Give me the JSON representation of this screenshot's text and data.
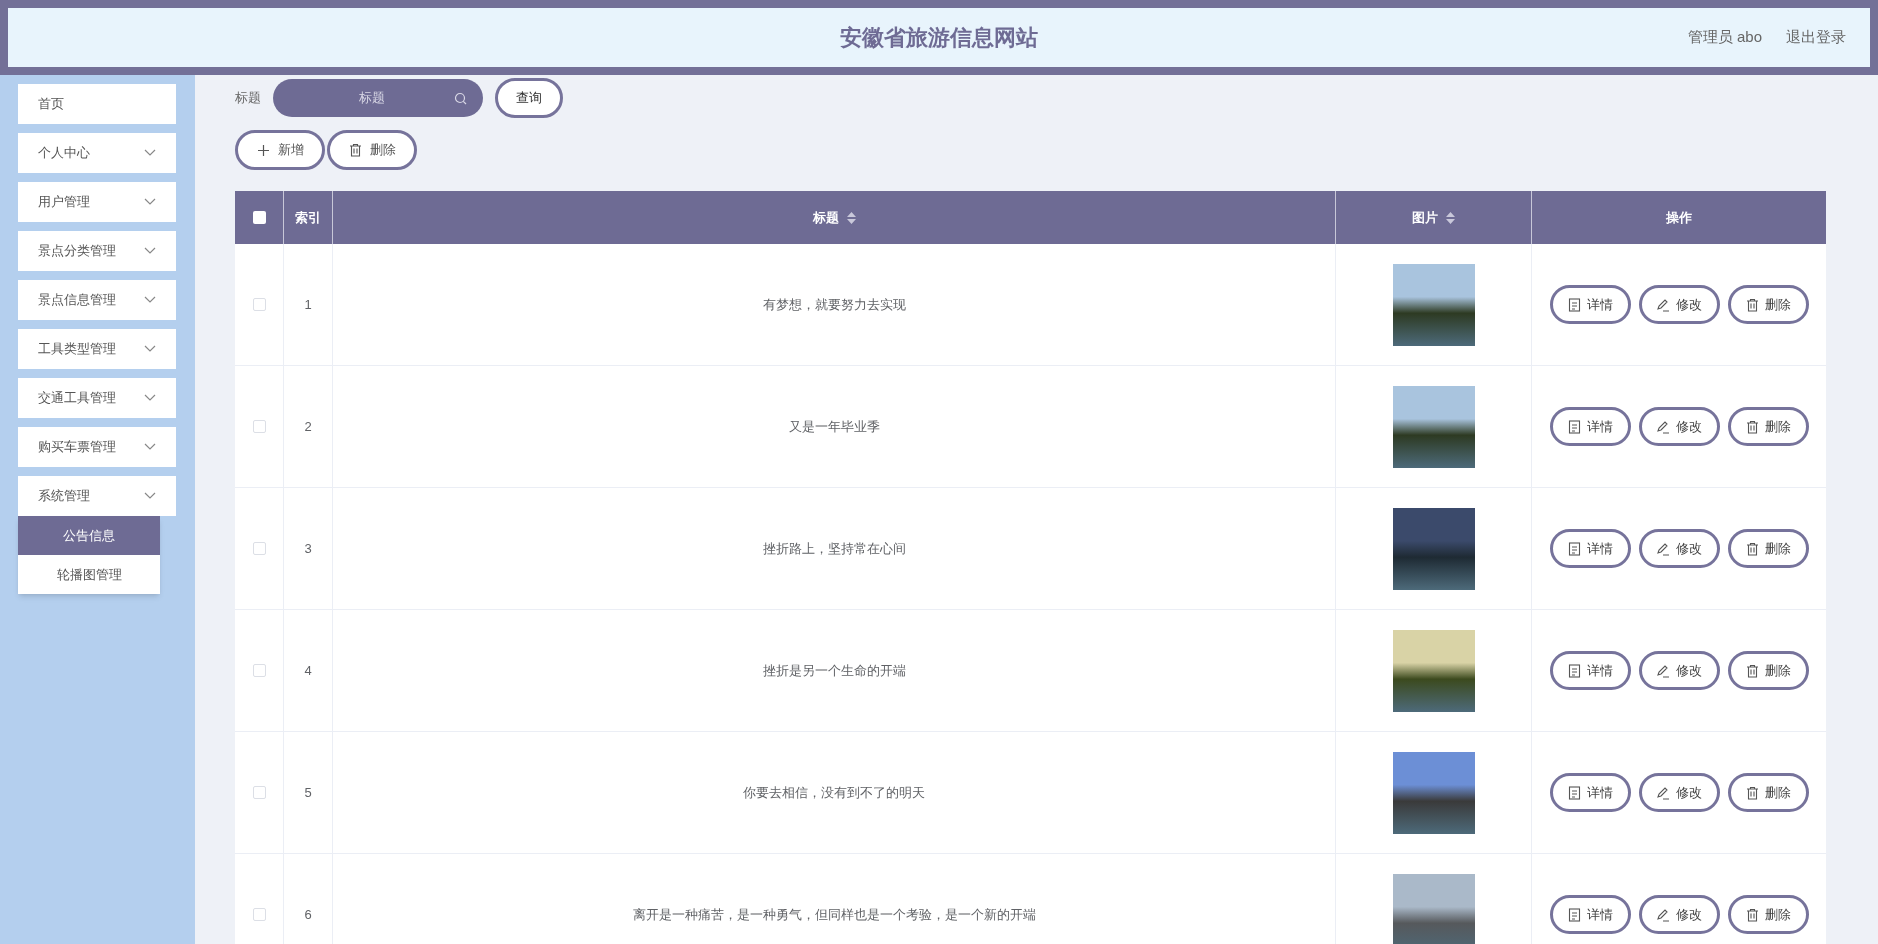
{
  "header": {
    "title": "安徽省旅游信息网站",
    "user": "管理员 abo",
    "logout": "退出登录"
  },
  "sidebar": {
    "items": [
      {
        "label": "首页",
        "kind": "link"
      },
      {
        "label": "个人中心",
        "kind": "submenu"
      },
      {
        "label": "用户管理",
        "kind": "submenu"
      },
      {
        "label": "景点分类管理",
        "kind": "submenu"
      },
      {
        "label": "景点信息管理",
        "kind": "submenu"
      },
      {
        "label": "工具类型管理",
        "kind": "submenu"
      },
      {
        "label": "交通工具管理",
        "kind": "submenu"
      },
      {
        "label": "购买车票管理",
        "kind": "submenu"
      },
      {
        "label": "系统管理",
        "kind": "submenu",
        "children": [
          {
            "label": "公告信息",
            "selected": true
          },
          {
            "label": "轮播图管理",
            "selected": false
          }
        ]
      }
    ]
  },
  "search": {
    "label": "标题",
    "placeholder": "标题",
    "button": "查询"
  },
  "toolbar": [
    {
      "label": "新增",
      "kind": "add"
    },
    {
      "label": "删除",
      "kind": "delete"
    }
  ],
  "table": {
    "select_all": {
      "checked": false
    },
    "columns": [
      {
        "label": "索引",
        "sortable": false
      },
      {
        "label": "标题",
        "sortable": true
      },
      {
        "label": "图片",
        "sortable": true
      },
      {
        "label": "操作",
        "sortable": false
      }
    ],
    "rows": [
      {
        "index": "1",
        "title": "有梦想，就要努力去实现",
        "checked": false,
        "actions": [
          {
            "label": "详情",
            "kind": "detail"
          },
          {
            "label": "修改",
            "kind": "edit"
          },
          {
            "label": "删除",
            "kind": "delete"
          }
        ]
      },
      {
        "index": "2",
        "title": "又是一年毕业季",
        "checked": false,
        "actions": [
          {
            "label": "详情",
            "kind": "detail"
          },
          {
            "label": "修改",
            "kind": "edit"
          },
          {
            "label": "删除",
            "kind": "delete"
          }
        ]
      },
      {
        "index": "3",
        "title": "挫折路上，坚持常在心间",
        "checked": false,
        "actions": [
          {
            "label": "详情",
            "kind": "detail"
          },
          {
            "label": "修改",
            "kind": "edit"
          },
          {
            "label": "删除",
            "kind": "delete"
          }
        ]
      },
      {
        "index": "4",
        "title": "挫折是另一个生命的开端",
        "checked": false,
        "actions": [
          {
            "label": "详情",
            "kind": "detail"
          },
          {
            "label": "修改",
            "kind": "edit"
          },
          {
            "label": "删除",
            "kind": "delete"
          }
        ]
      },
      {
        "index": "5",
        "title": "你要去相信，没有到不了的明天",
        "checked": false,
        "actions": [
          {
            "label": "详情",
            "kind": "detail"
          },
          {
            "label": "修改",
            "kind": "edit"
          },
          {
            "label": "删除",
            "kind": "delete"
          }
        ]
      },
      {
        "index": "6",
        "title": "离开是一种痛苦，是一种勇气，但同样也是一个考验，是一个新的开端",
        "checked": false,
        "actions": [
          {
            "label": "详情",
            "kind": "detail"
          },
          {
            "label": "修改",
            "kind": "edit"
          },
          {
            "label": "删除",
            "kind": "delete"
          }
        ]
      }
    ]
  }
}
